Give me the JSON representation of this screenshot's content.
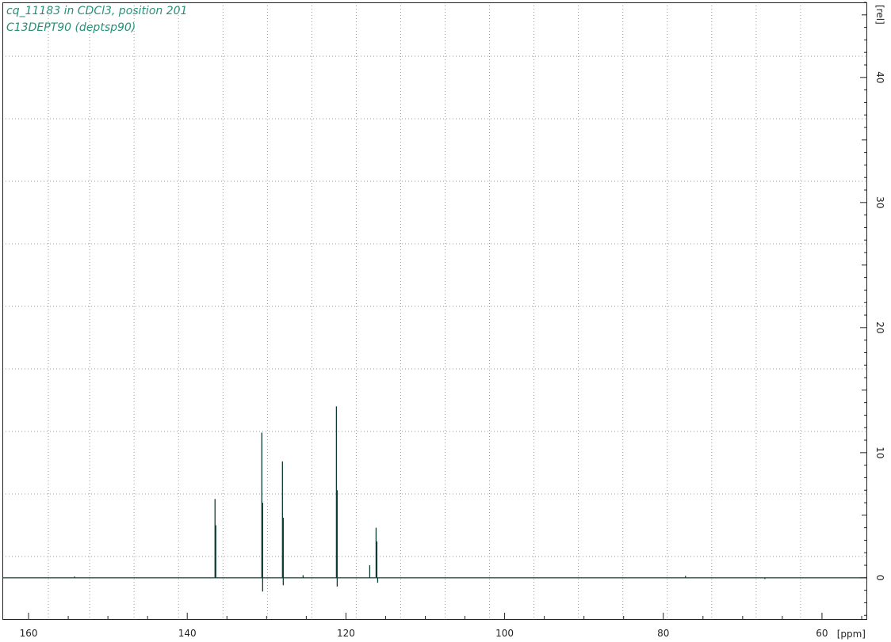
{
  "title_lines": [
    "cq_11183 in CDCl3, position 201",
    "C13DEPT90 (deptsp90)"
  ],
  "colors": {
    "title": "#2a8f78",
    "spectrum": "#0d3b36",
    "grid": "#9a9a9a",
    "axis": "#222222"
  },
  "chart_data": {
    "type": "line",
    "title": "cq_11183 in CDCl3, position 201",
    "subtitle": "C13DEPT90 (deptsp90)",
    "xlabel": "[ppm]",
    "ylabel": "[rel]",
    "xlim": [
      163.3,
      54.4
    ],
    "ylim": [
      -3.3,
      46
    ],
    "x_reversed": true,
    "x_ticks": [
      160,
      140,
      120,
      100,
      80,
      60
    ],
    "x_tick_labels": [
      "160",
      "140",
      "120",
      "100",
      "80",
      "60"
    ],
    "x_minor_step": 5,
    "x_grid": [
      157.5,
      152.3,
      146.7,
      141.1,
      135.5,
      129.9,
      124.3,
      118.7,
      113.1,
      107.5,
      101.9,
      96.3,
      90.7,
      85.1,
      79.5,
      73.9,
      68.3,
      62.7
    ],
    "y_ticks": [
      0,
      10,
      20,
      30,
      40
    ],
    "y_tick_labels": [
      "0",
      "10",
      "20",
      "30",
      "40"
    ],
    "y_minor_step": 1,
    "y_grid": [
      1.7,
      6.7,
      11.7,
      16.7,
      21.7,
      26.7,
      31.7,
      36.7,
      41.7
    ],
    "grid": true,
    "series": [
      {
        "peaks": [
          {
            "x": 136.5,
            "y": 6.3
          },
          {
            "x": 136.4,
            "y": 4.2
          },
          {
            "x": 130.6,
            "y": 11.6
          },
          {
            "x": 130.5,
            "y": 6.0
          },
          {
            "x": 130.5,
            "y": -1.1
          },
          {
            "x": 128.0,
            "y": 9.3
          },
          {
            "x": 127.9,
            "y": 4.8
          },
          {
            "x": 127.9,
            "y": -0.6
          },
          {
            "x": 121.2,
            "y": 13.7
          },
          {
            "x": 121.1,
            "y": 7.0
          },
          {
            "x": 121.1,
            "y": -0.7
          },
          {
            "x": 117.0,
            "y": 1.0
          },
          {
            "x": 116.2,
            "y": 4.0
          },
          {
            "x": 116.1,
            "y": 2.9
          },
          {
            "x": 116.0,
            "y": -0.4
          },
          {
            "x": 154.2,
            "y": 0.1
          },
          {
            "x": 125.4,
            "y": 0.2
          },
          {
            "x": 77.2,
            "y": 0.15
          },
          {
            "x": 67.2,
            "y": -0.1
          }
        ]
      }
    ]
  }
}
